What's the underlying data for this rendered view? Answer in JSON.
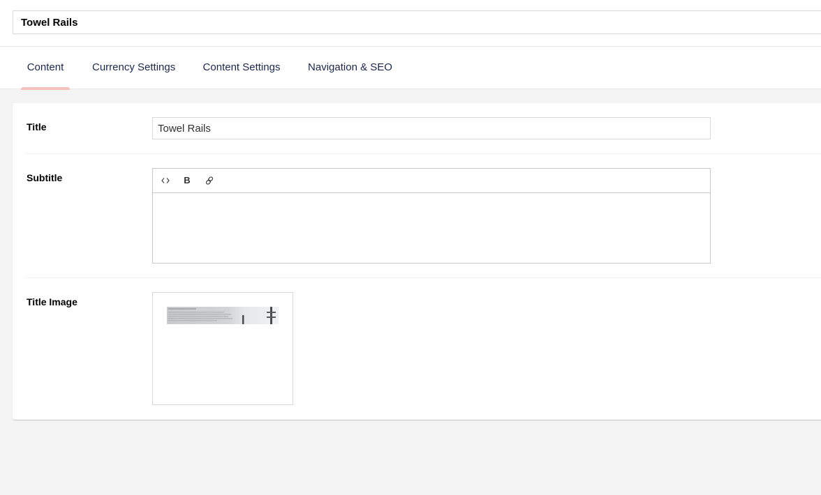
{
  "header": {
    "name_value": "Towel Rails"
  },
  "tabs": [
    {
      "label": "Content",
      "active": true
    },
    {
      "label": "Currency Settings",
      "active": false
    },
    {
      "label": "Content Settings",
      "active": false
    },
    {
      "label": "Navigation & SEO",
      "active": false
    }
  ],
  "form": {
    "title": {
      "label": "Title",
      "value": "Towel Rails"
    },
    "subtitle": {
      "label": "Subtitle",
      "toolbar": {
        "code_icon": "code-icon",
        "bold_label": "B",
        "link_icon": "link-icon"
      }
    },
    "title_image": {
      "label": "Title Image",
      "thumbnail": "towel-rail-banner-thumbnail"
    }
  },
  "colors": {
    "accent": "#f5c1bc",
    "text": "#1b264f",
    "background": "#f4f3f3"
  }
}
